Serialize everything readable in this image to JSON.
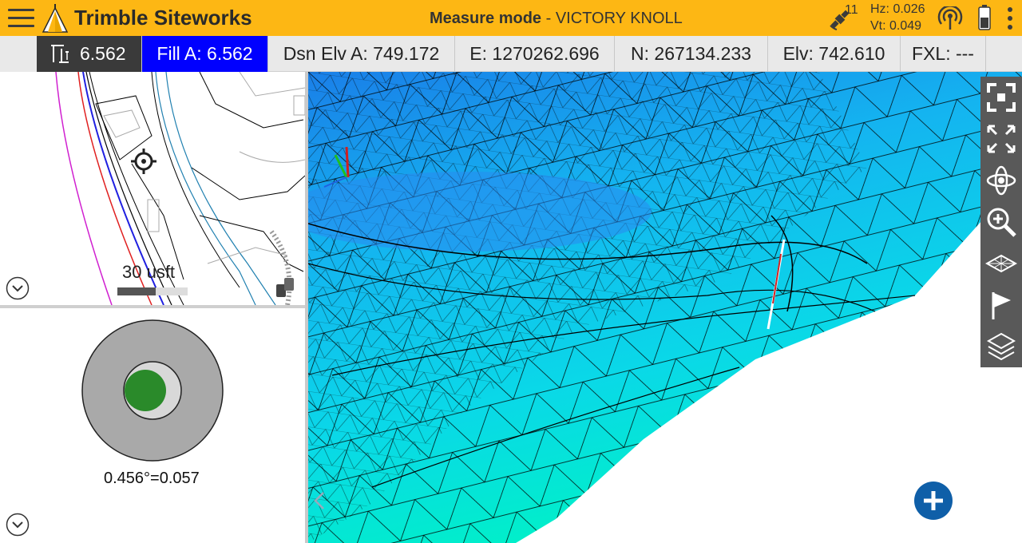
{
  "app": {
    "title": "Trimble Siteworks",
    "mode_label": "Measure mode",
    "mode_separator": " - ",
    "project": "VICTORY KNOLL"
  },
  "gnss": {
    "satellites": "11",
    "hz": "Hz: 0.026",
    "vt": "Vt: 0.049"
  },
  "icons": {
    "menu": "menu-icon",
    "logo": "trimble-logo-icon",
    "satellite": "satellite-icon",
    "radio": "radio-signal-icon",
    "battery": "battery-icon",
    "more": "more-vert-icon"
  },
  "statusbar": {
    "tool_value": "6.562",
    "fill": "Fill A: 6.562",
    "design_elevation": "Dsn Elv A: 749.172",
    "easting": "E: 1270262.696",
    "northing": "N: 267134.233",
    "elevation": "Elv: 742.610",
    "fxl": "FXL: ---"
  },
  "plan_view": {
    "scale_label": "30 usft"
  },
  "bubble": {
    "tilt_readout": "0.456°=0.057"
  },
  "toolbar_3d": [
    {
      "name": "zoom-extents-icon"
    },
    {
      "name": "fullscreen-icon"
    },
    {
      "name": "orbit-icon"
    },
    {
      "name": "zoom-in-icon"
    },
    {
      "name": "surface-icon"
    },
    {
      "name": "flag-icon"
    },
    {
      "name": "layers-icon"
    }
  ],
  "colors": {
    "header": "#FDB714",
    "fill_cell": "#0000ff",
    "tool_cell": "#3a3a3a",
    "fab": "#0f5fa8",
    "bubble_dot": "#2a8a2a",
    "surface_light": "#00e8f0",
    "surface_dark": "#1a7fe8"
  }
}
